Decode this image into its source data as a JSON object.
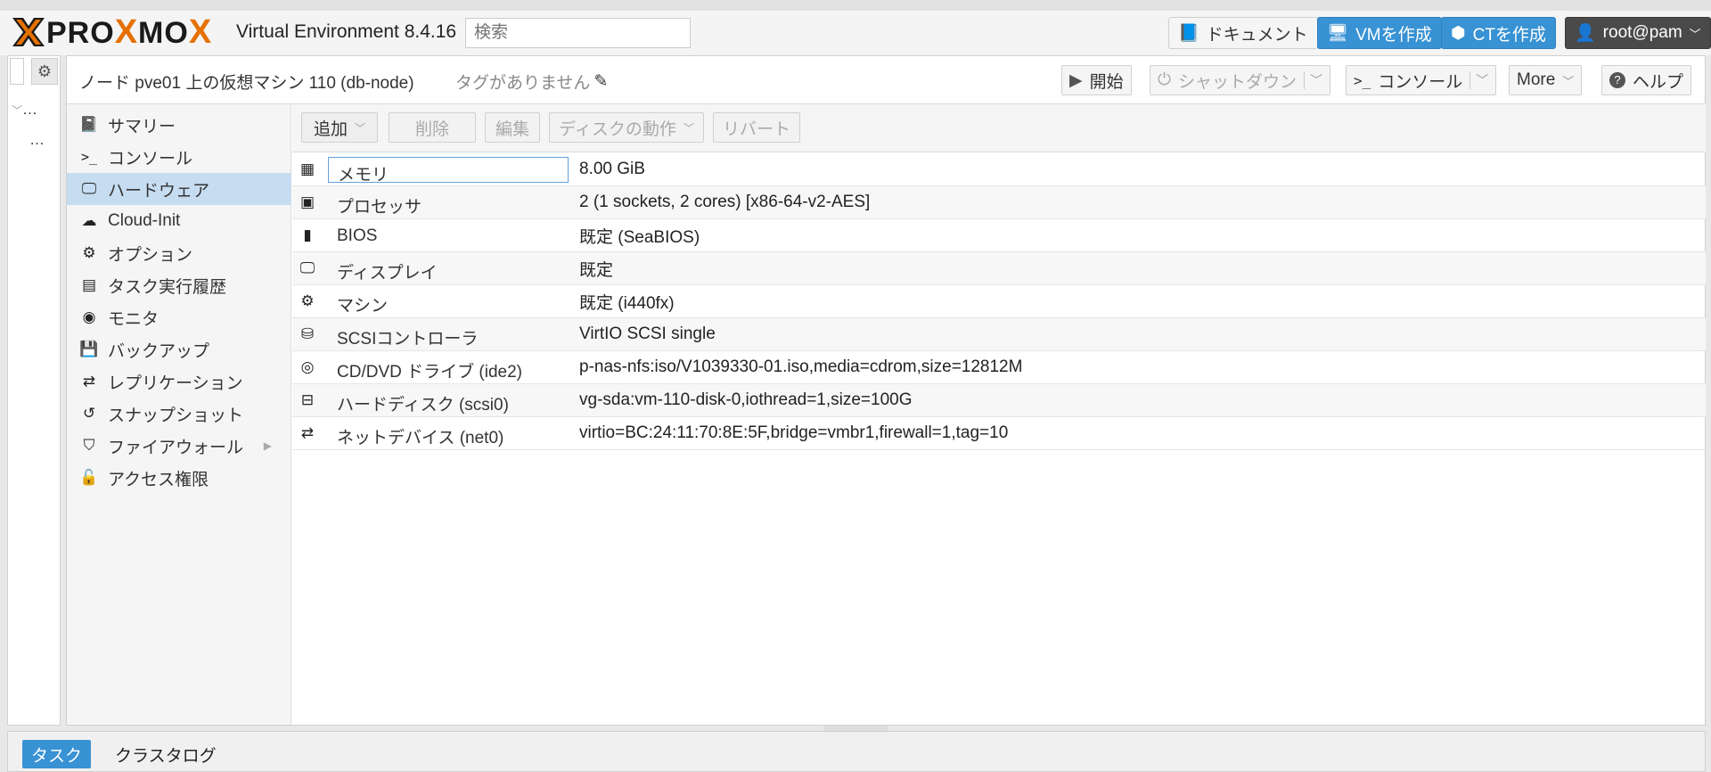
{
  "header": {
    "logo_text": "PROXMOX",
    "product": "Virtual Environment 8.4.16",
    "search_placeholder": "検索",
    "docs": "ドキュメント",
    "create_vm": "VMを作成",
    "create_ct": "CTを作成",
    "user": "root@pam"
  },
  "tree": {
    "row1": "…",
    "row2": "…"
  },
  "vm": {
    "title": "ノード pve01 上の仮想マシン 110 (db-node)",
    "tags": "タグがありません"
  },
  "actions": {
    "start": "開始",
    "shutdown": "シャットダウン",
    "console": "コンソール",
    "more": "More",
    "help": "ヘルプ"
  },
  "nav": [
    {
      "label": "サマリー",
      "icon": "book-icon"
    },
    {
      "label": "コンソール",
      "icon": "terminal-icon"
    },
    {
      "label": "ハードウェア",
      "icon": "monitor-icon"
    },
    {
      "label": "Cloud-Init",
      "icon": "cloud-icon"
    },
    {
      "label": "オプション",
      "icon": "gear-icon"
    },
    {
      "label": "タスク実行履歴",
      "icon": "list-icon"
    },
    {
      "label": "モニタ",
      "icon": "eye-icon"
    },
    {
      "label": "バックアップ",
      "icon": "floppy-icon"
    },
    {
      "label": "レプリケーション",
      "icon": "retweet-icon"
    },
    {
      "label": "スナップショット",
      "icon": "history-icon"
    },
    {
      "label": "ファイアウォール",
      "icon": "shield-icon"
    },
    {
      "label": "アクセス権限",
      "icon": "unlock-icon"
    }
  ],
  "toolbar": {
    "add": "追加",
    "remove": "削除",
    "edit": "編集",
    "disk_action": "ディスクの動作",
    "revert": "リバート"
  },
  "hardware": [
    {
      "name": "メモリ",
      "value": "8.00 GiB",
      "icon": "memory-icon"
    },
    {
      "name": "プロセッサ",
      "value": "2 (1 sockets, 2 cores) [x86-64-v2-AES]",
      "icon": "cpu-icon"
    },
    {
      "name": "BIOS",
      "value": "既定 (SeaBIOS)",
      "icon": "microchip-icon"
    },
    {
      "name": "ディスプレイ",
      "value": "既定",
      "icon": "desktop-icon"
    },
    {
      "name": "マシン",
      "value": "既定 (i440fx)",
      "icon": "cogs-icon"
    },
    {
      "name": "SCSIコントローラ",
      "value": "VirtIO SCSI single",
      "icon": "database-icon"
    },
    {
      "name": "CD/DVD ドライブ (ide2)",
      "value": "p-nas-nfs:iso/V1039330-01.iso,media=cdrom,size=12812M",
      "icon": "cdrom-icon"
    },
    {
      "name": "ハードディスク (scsi0)",
      "value": "vg-sda:vm-110-disk-0,iothread=1,size=100G",
      "icon": "hdd-icon"
    },
    {
      "name": "ネットデバイス (net0)",
      "value": "virtio=BC:24:11:70:8E:5F,bridge=vmbr1,firewall=1,tag=10",
      "icon": "exchange-icon"
    }
  ],
  "bottom": {
    "tasks": "タスク",
    "cluster_log": "クラスタログ"
  }
}
